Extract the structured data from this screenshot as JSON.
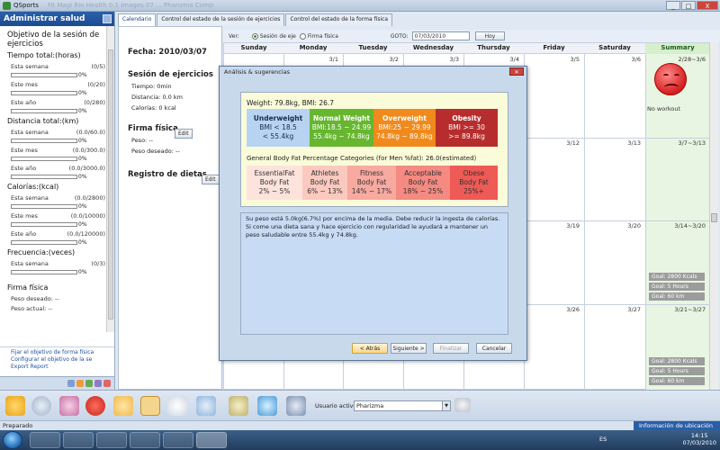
{
  "window": {
    "title": "QSports",
    "ghost_title": "Fit Magi Rio Health 0.1   Images 07    ...   Pharizma Comp",
    "controls": [
      "_",
      "□",
      "X"
    ]
  },
  "left_panel": {
    "header": "Administrar salud",
    "section_title": "Objetivo de la sesión de ejercicios",
    "groups": [
      {
        "title": "Tiempo total:(horas)",
        "rows": [
          {
            "label": "Esta semana",
            "value": "(0/5)",
            "pct": "0%"
          },
          {
            "label": "Este mes",
            "value": "(0/20)",
            "pct": "0%"
          },
          {
            "label": "Este año",
            "value": "(0/280)",
            "pct": "0%"
          }
        ]
      },
      {
        "title": "Distancia total:(km)",
        "rows": [
          {
            "label": "Esta semana",
            "value": "(0.0/60.0)",
            "pct": "0%"
          },
          {
            "label": "Este mes",
            "value": "(0.0/300.0)",
            "pct": "0%"
          },
          {
            "label": "Este año",
            "value": "(0.0/3000.0)",
            "pct": "0%"
          }
        ]
      },
      {
        "title": "Calorías:(kcal)",
        "rows": [
          {
            "label": "Esta semana",
            "value": "(0.0/2800)",
            "pct": "0%"
          },
          {
            "label": "Este mes",
            "value": "(0.0/10000)",
            "pct": "0%"
          },
          {
            "label": "Este año",
            "value": "(0.0/120000)",
            "pct": "0%"
          }
        ]
      },
      {
        "title": "Frecuencia:(veces)",
        "rows": [
          {
            "label": "Esta semana",
            "value": "(0/3)",
            "pct": "0%"
          }
        ]
      }
    ],
    "firma_title": "Firma física",
    "peso_deseado": "Peso deseado: --",
    "peso_actual": "Peso actual: --",
    "links": [
      "Fijar el objetivo de forma física",
      "Configurar el objetivo de la se",
      "Export Report"
    ]
  },
  "tabs": [
    "Calendario",
    "Control del estado de la sesión de ejercicios",
    "Control del estado de la forma física"
  ],
  "middle": {
    "fecha": "Fecha:  2010/03/07",
    "sesion_title": "Sesión de ejercicios",
    "tiempo": "Tiempo:  0min",
    "distancia": "Distancia:  0.0 km",
    "calorias": "Calorías:  0 kcal",
    "firma_title": "Firma física",
    "peso": "Peso:  --",
    "peso_deseado": "Peso deseado:  --",
    "dietas_title": "Registro de dietas",
    "edit_label": "Edit"
  },
  "calendar_toolbar": {
    "ver_label": "Ver:",
    "radio1": "Sesión de eje",
    "radio2": "Firma física",
    "goto_label": "GOTO:",
    "goto_value": "07/03/2010",
    "hoy_label": "Hoy"
  },
  "calendar": {
    "days": [
      "Sunday",
      "Monday",
      "Tuesday",
      "Wednesday",
      "Thursday",
      "Friday",
      "Saturday",
      "Summary"
    ],
    "row1_dates": [
      "3/1",
      "3/2",
      "3/3",
      "3/4",
      "3/5",
      "3/6",
      "2/28~3/6"
    ],
    "row2_dates": [
      "3/12",
      "3/13",
      "3/7~3/13"
    ],
    "row3_dates": [
      "3/19",
      "3/20",
      "3/14~3/20"
    ],
    "row4_dates": [
      "3/26",
      "3/27",
      "3/21~3/27"
    ],
    "no_workout": "No workout",
    "goals_row3": [
      "Goal: 2800 Kcals",
      "Goal: 5 Hours",
      "Goal: 60 km"
    ],
    "goals_row4": [
      "Goal: 2800 Kcals",
      "Goal: 5 Hours",
      "Goal: 60 km"
    ]
  },
  "dialog": {
    "title": "Análisis & sugerencias",
    "weight_line": "Weight: 79.8kg, BMI: 26.7",
    "bmi": [
      {
        "name": "Underweight",
        "l2": "BMI < 18.5",
        "l3": "< 55.4kg",
        "color": "#b8d3f2",
        "text_color": "#1a2a4a"
      },
      {
        "name": "Normal Weight",
        "l2": "BMI:18.5 ~ 24.99",
        "l3": "55.4kg ~ 74.8kg",
        "color": "#66b62f",
        "text_color": "#ffffff"
      },
      {
        "name": "Overweight",
        "l2": "BMI:25 ~ 29.99",
        "l3": "74.8kg ~ 89.8kg",
        "color": "#f08a1c",
        "text_color": "#ffffff"
      },
      {
        "name": "Obesity",
        "l2": "BMI >= 30",
        "l3": ">= 89.8kg",
        "color": "#b72d2d",
        "text_color": "#ffffff"
      }
    ],
    "fat_title": "General Body Fat Percentage Categories (for Men %fat): 26.0(estimated)",
    "fat": [
      {
        "name": "EssentialFat",
        "l2": "Body Fat",
        "l3": "2% ~ 5%",
        "color": "#fde3dc"
      },
      {
        "name": "Athletes",
        "l2": "Body Fat",
        "l3": "6% ~ 13%",
        "color": "#fbc9bf"
      },
      {
        "name": "Fitness",
        "l2": "Body Fat",
        "l3": "14% ~ 17%",
        "color": "#f8a9a0"
      },
      {
        "name": "Acceptable",
        "l2": "Body Fat",
        "l3": "18% ~ 25%",
        "color": "#f48a82"
      },
      {
        "name": "Obese",
        "l2": "Body Fat",
        "l3": "25%+",
        "color": "#ee5a56"
      }
    ],
    "advice": "Su peso está 5.0kg(6.7%) por encima de la media. Debe reducir la ingesta de calorías. Si come una dieta sana y hace ejercicio con regularidad le ayudará a mantener un peso saludable entre 55.4kg y 74.8kg.",
    "btn_back": "< Atrás",
    "btn_next": "Siguiente >",
    "btn_finish": "Finalizar",
    "btn_cancel": "Cancelar"
  },
  "bottom": {
    "active_user_label": "Usuario activo:",
    "active_user": "Pharizma"
  },
  "status": {
    "left": "Preparado",
    "right": "Información de ubicación"
  },
  "taskbar": {
    "lang": "ES",
    "time": "14:15",
    "date": "07/03/2010"
  }
}
